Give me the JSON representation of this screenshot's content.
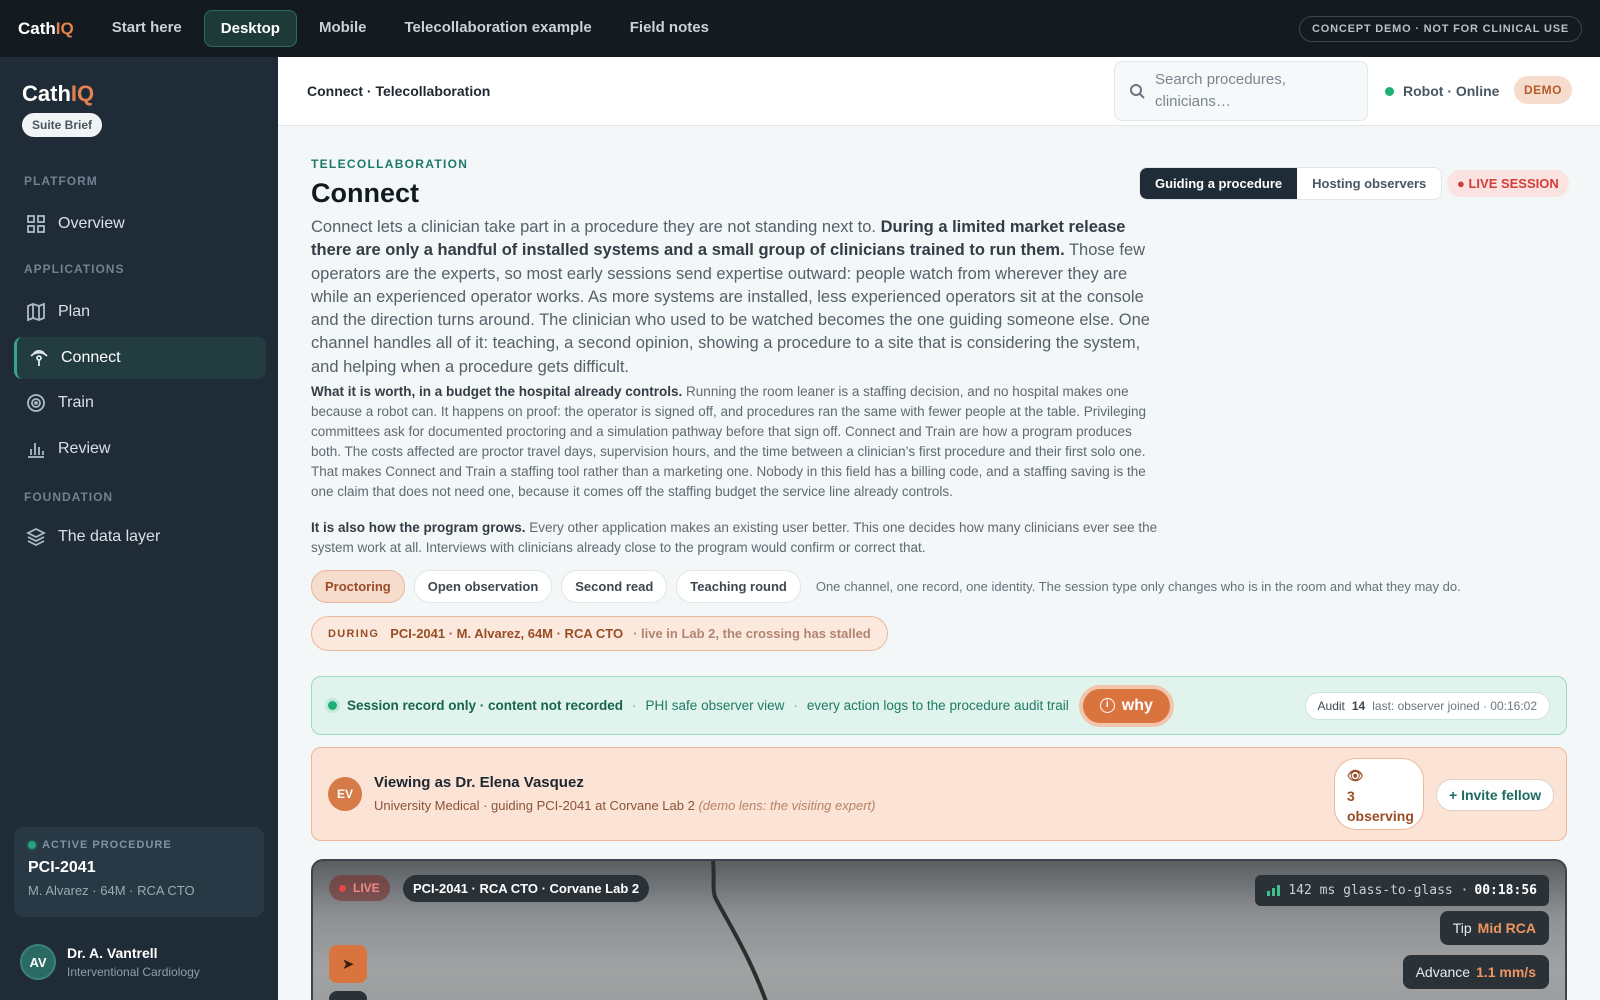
{
  "topbar": {
    "brand_a": "Cath",
    "brand_b": "IQ",
    "nav": [
      "Start here",
      "Desktop",
      "Mobile",
      "Telecollaboration example",
      "Field notes"
    ],
    "badge": "CONCEPT DEMO · NOT FOR CLINICAL USE"
  },
  "sidebar": {
    "brand_a": "Cath",
    "brand_b": "IQ",
    "suite_label": "Suite Brief",
    "section_platform": "PLATFORM",
    "section_applications": "APPLICATIONS",
    "section_foundation": "FOUNDATION",
    "items": [
      {
        "label": "Overview",
        "icon": "grid-icon"
      },
      {
        "label": "Plan",
        "icon": "map-icon"
      },
      {
        "label": "Connect",
        "icon": "signal-icon"
      },
      {
        "label": "Train",
        "icon": "target-icon"
      },
      {
        "label": "Review",
        "icon": "bar-chart-icon"
      },
      {
        "label": "The data layer",
        "icon": "layers-icon"
      }
    ],
    "active_proc": {
      "label": "ACTIVE PROCEDURE",
      "id": "PCI-2041",
      "sub": "M. Alvarez · 64M · RCA CTO"
    },
    "user": {
      "initials": "AV",
      "name": "Dr. A. Vantrell",
      "role": "Interventional Cardiology"
    }
  },
  "header": {
    "breadcrumb": "Connect · Telecollaboration",
    "search_placeholder": "Search procedures, clinicians…",
    "robot_status": "Robot · Online",
    "demo": "DEMO"
  },
  "main": {
    "eyebrow": "TELECOLLABORATION",
    "title": "Connect",
    "mode_guiding": "Guiding a procedure",
    "mode_hosting": "Hosting observers",
    "live_session": "● LIVE SESSION",
    "lead_a": "Connect lets a clinician take part in a procedure they are not standing next to. ",
    "lead_b": "During a limited market release there are only a handful of installed systems and a small group of clinicians trained to run them.",
    "lead_c": " Those few operators are the experts, so most early sessions send expertise outward: people watch from wherever they are while an experienced operator works. As more systems are installed, less experienced operators sit at the console and the direction turns around. The clinician who used to be watched becomes the one guiding someone else. One channel handles all of it: teaching, a second opinion, showing a procedure to a site that is considering the system, and helping when a procedure gets difficult.",
    "p2_bold": "What it is worth, in a budget the hospital already controls.",
    "p2_text": " Running the room leaner is a staffing decision, and no hospital makes one because a robot can. It happens on proof: the operator is signed off, and procedures ran the same with fewer people at the table. Privileging committees ask for documented proctoring and a simulation pathway before that sign off. Connect and Train are how a program produces both. The costs affected are proctor travel days, supervision hours, and the time between a clinician’s first procedure and their first solo one. That makes Connect and Train a staffing tool rather than a marketing one. Nobody in this field has a billing code, and a staffing saving is the one claim that does not need one, because it comes off the staffing budget the service line already controls.",
    "p3_bold": "It is also how the program grows.",
    "p3_text": " Every other application makes an existing user better. This one decides how many clinicians ever see the system work at all. Interviews with clinicians already close to the program would confirm or correct that.",
    "chips": [
      "Proctoring",
      "Open observation",
      "Second read",
      "Teaching round"
    ],
    "chip_note": "One channel, one record, one identity. The session type only changes who is in the room and what they may do.",
    "during": {
      "tag": "DURING",
      "case": "PCI-2041 · M. Alvarez, 64M · RCA CTO",
      "note": "· live in Lab 2, the crossing has stalled"
    },
    "record": {
      "main": "Session record only · content not recorded",
      "sep": "·",
      "phi": "PHI safe observer view",
      "audit_note": "every action logs to the procedure audit trail",
      "why": "why",
      "audit_label": "Audit",
      "audit_count": "14",
      "audit_last": "last: observer joined · 00:16:02"
    },
    "viewer": {
      "initials": "EV",
      "title": "Viewing as Dr. Elena Vasquez",
      "sub": "University Medical · guiding PCI-2041 at Corvane Lab 2 ",
      "sub_note": "(demo lens: the visiting expert)",
      "observing_count": "3",
      "observing_label": "observing",
      "invite": "+ Invite fellow"
    },
    "video": {
      "live": "LIVE",
      "case": "PCI-2041 · RCA CTO · Corvane Lab 2",
      "latency": "142 ms glass-to-glass ·",
      "timer": "00:18:56",
      "tip_label": "Tip",
      "tip_value": "Mid RCA",
      "advance_label": "Advance",
      "advance_value": "1.1 mm/s"
    }
  },
  "colors": {
    "accent": "#d9743f",
    "brand_orange": "#e3824e",
    "teal": "#1f7a6c",
    "live_red": "#d23f3a",
    "online_green": "#1fae78"
  }
}
